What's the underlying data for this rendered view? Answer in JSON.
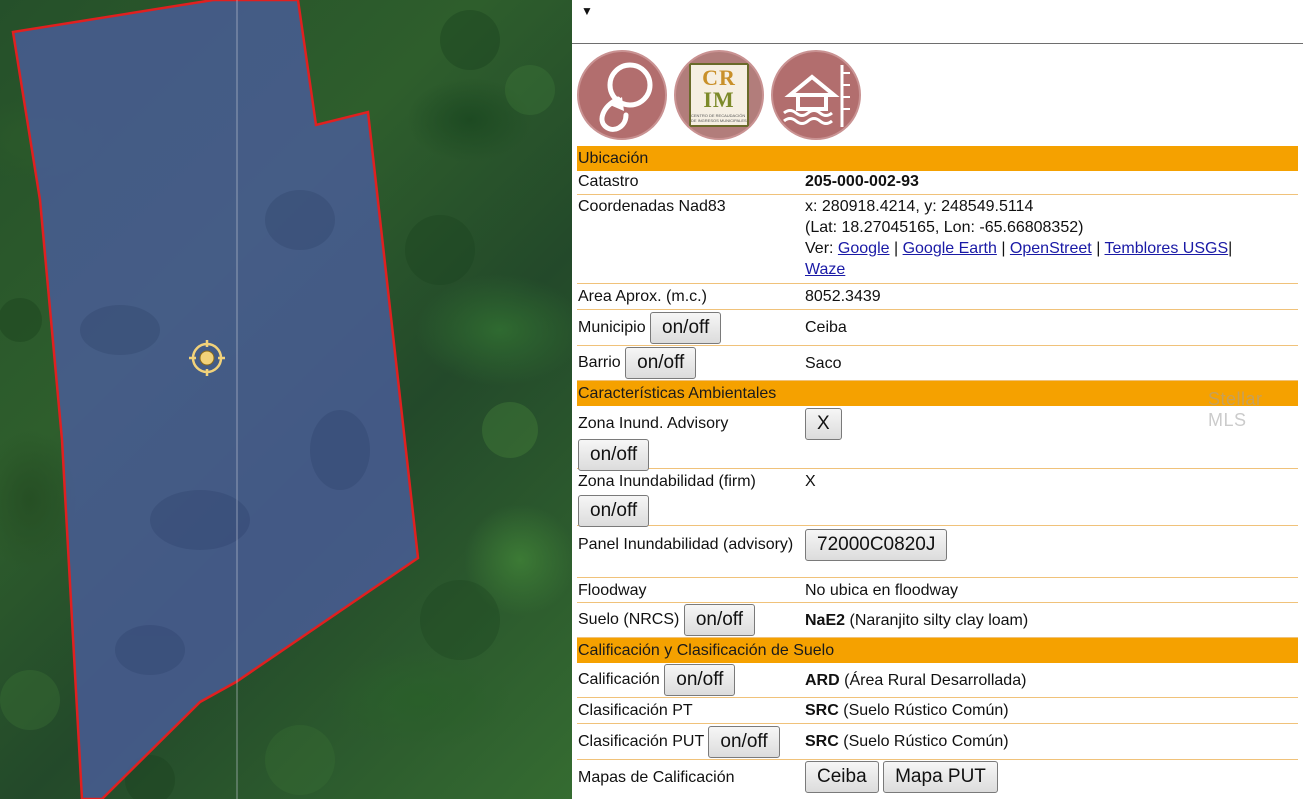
{
  "map": {
    "target_icon": "crosshair-target-icon",
    "parcel_fill": "#4a5d9a",
    "parcel_border": "#e02020"
  },
  "panel": {
    "menu_caret": "▼",
    "logos": [
      {
        "name": "search-refresh-logo-icon"
      },
      {
        "name": "crim-logo",
        "text_top": "CR",
        "text_bottom": "IM",
        "subtext": "CENTRO DE RECAUDACIÓN DE INGRESOS MUNICIPALES"
      },
      {
        "name": "flood-house-logo-icon"
      }
    ],
    "sections": {
      "ubicacion": {
        "title": "Ubicación",
        "catastro_label": "Catastro",
        "catastro_value": "205-000-002-93",
        "coords_label": "Coordenadas Nad83",
        "coords_xy": "x: 280918.4214, y: 248549.5114",
        "coords_latlon": "(Lat: 18.27045165, Lon: -65.66808352)",
        "ver_prefix": "Ver:",
        "links": [
          "Google",
          "Google Earth",
          "OpenStreet",
          "Temblores USGS",
          "Waze"
        ],
        "sep": "|",
        "area_label": "Area Aprox. (m.c.)",
        "area_value": "8052.3439",
        "municipio_label": "Municipio",
        "municipio_value": "Ceiba",
        "barrio_label": "Barrio",
        "barrio_value": "Saco",
        "toggle": "on/off"
      },
      "ambiental": {
        "title": "Características Ambientales",
        "zona_adv_label": "Zona Inund. Advisory",
        "zona_adv_value": "X",
        "zona_firm_label": "Zona Inundabilidad (firm)",
        "zona_firm_value": "X",
        "panel_label": "Panel Inundabilidad (advisory)",
        "panel_value": "72000C0820J",
        "floodway_label": "Floodway",
        "floodway_value": "No ubica en floodway",
        "suelo_label": "Suelo (NRCS)",
        "suelo_code": "NaE2",
        "suelo_desc": "(Naranjito silty clay loam)"
      },
      "calificacion": {
        "title": "Calificación y Clasificación de Suelo",
        "calif_label": "Calificación",
        "calif_code": "ARD",
        "calif_desc": "(Área Rural Desarrollada)",
        "clas_pt_label": "Clasificación PT",
        "clas_pt_code": "SRC",
        "clas_pt_desc": "(Suelo Rústico Común)",
        "clas_put_label": "Clasificación PUT",
        "clas_put_code": "SRC",
        "clas_put_desc": "(Suelo Rústico Común)",
        "mapas_label": "Mapas de Calificación",
        "mapas_btn1": "Ceiba",
        "mapas_btn2": "Mapa PUT"
      }
    },
    "watermark": "Stellar MLS"
  }
}
